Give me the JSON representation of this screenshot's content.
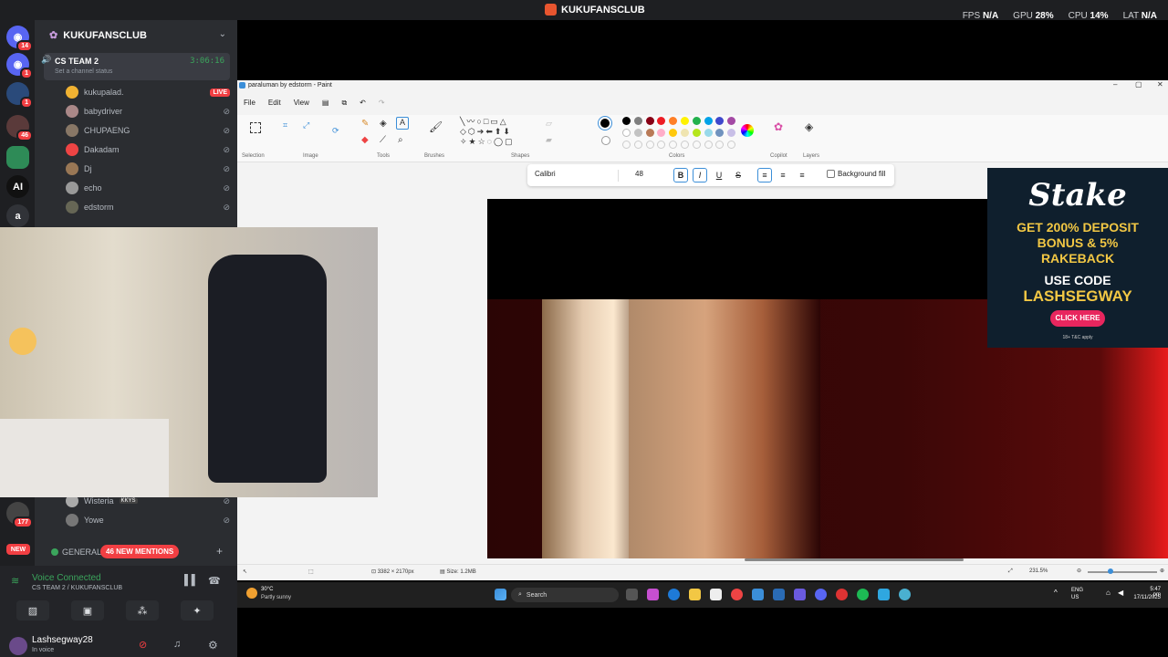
{
  "overlay": {
    "stream_title": "KUKUFANSCLUB",
    "stats": [
      {
        "label": "FPS",
        "value": "N/A"
      },
      {
        "label": "GPU",
        "value": "28%"
      },
      {
        "label": "CPU",
        "value": "14%"
      },
      {
        "label": "LAT",
        "value": "N/A"
      }
    ]
  },
  "servers": [
    {
      "icon": "discord-icon",
      "badge": "14"
    },
    {
      "icon": "discord-icon",
      "badge": "1"
    },
    {
      "icon": "server-avatar",
      "badge": "1"
    },
    {
      "icon": "server-avatar",
      "badge": "46"
    },
    {
      "icon": "server-avatar",
      "badge": ""
    },
    {
      "icon": "ai-icon",
      "label": "AI",
      "badge": ""
    },
    {
      "icon": "letter-icon",
      "label": "a",
      "badge": ""
    }
  ],
  "rail_badges": {
    "b1": "177",
    "b2": "NEW"
  },
  "channel_panel": {
    "server_name": "KUKUFANSCLUB",
    "voice_channel": {
      "name": "CS TEAM 2",
      "time": "3:06:16",
      "status": "Set a channel status"
    },
    "members": [
      {
        "name": "kukupalad.",
        "live": "LIVE"
      },
      {
        "name": "babydriver"
      },
      {
        "name": "CHUPAENG"
      },
      {
        "name": "Dakadam"
      },
      {
        "name": "Dj"
      },
      {
        "name": "echo"
      },
      {
        "name": "edstorm"
      }
    ],
    "members_bottom": [
      {
        "name": "Wisteria",
        "tag": "KKYS"
      },
      {
        "name": "Yowe"
      }
    ],
    "general": "GENERAL",
    "mentions": "46 NEW MENTIONS"
  },
  "voice_bar": {
    "connected": "Voice Connected",
    "path": "CS TEAM 2 / KUKUFANSCLUB",
    "user": "Lashsegway28",
    "user_status": "In voice"
  },
  "paint": {
    "title": "paraluman by edstorm - Paint",
    "menu": [
      "File",
      "Edit",
      "View"
    ],
    "groups": [
      "Selection",
      "Image",
      "Tools",
      "Brushes",
      "Shapes",
      "Colors",
      "Copilot",
      "Layers"
    ],
    "font": "Calibri",
    "font_size": "48",
    "bg_fill": "Background fill",
    "dimensions": "3382 × 2170px",
    "size": "Size: 1.2MB",
    "zoom": "231.5%",
    "colors_row1": [
      "#000000",
      "#7f7f7f",
      "#880015",
      "#ed1c24",
      "#ff7f27",
      "#fff200",
      "#22b14c",
      "#00a2e8",
      "#3f48cc",
      "#a349a4"
    ],
    "colors_row2": [
      "#ffffff",
      "#c3c3c3",
      "#b97a57",
      "#ffaec9",
      "#ffc90e",
      "#efe4b0",
      "#b5e61d",
      "#99d9ea",
      "#7092be",
      "#c8bfe7"
    ]
  },
  "ad": {
    "brand": "Stake",
    "line1": "GET 200% DEPOSIT",
    "line2": "BONUS & 5%",
    "line3": "RAKEBACK",
    "code_label": "USE CODE",
    "code": "LASHSEGWAY",
    "cta": "CLICK HERE",
    "terms": "18+ T&C apply"
  },
  "taskbar": {
    "temp": "30°C",
    "weather": "Partly sunny",
    "search": "Search",
    "lang1": "ENG",
    "lang2": "US",
    "time": "5:47 pm",
    "date": "17/11/2025"
  }
}
